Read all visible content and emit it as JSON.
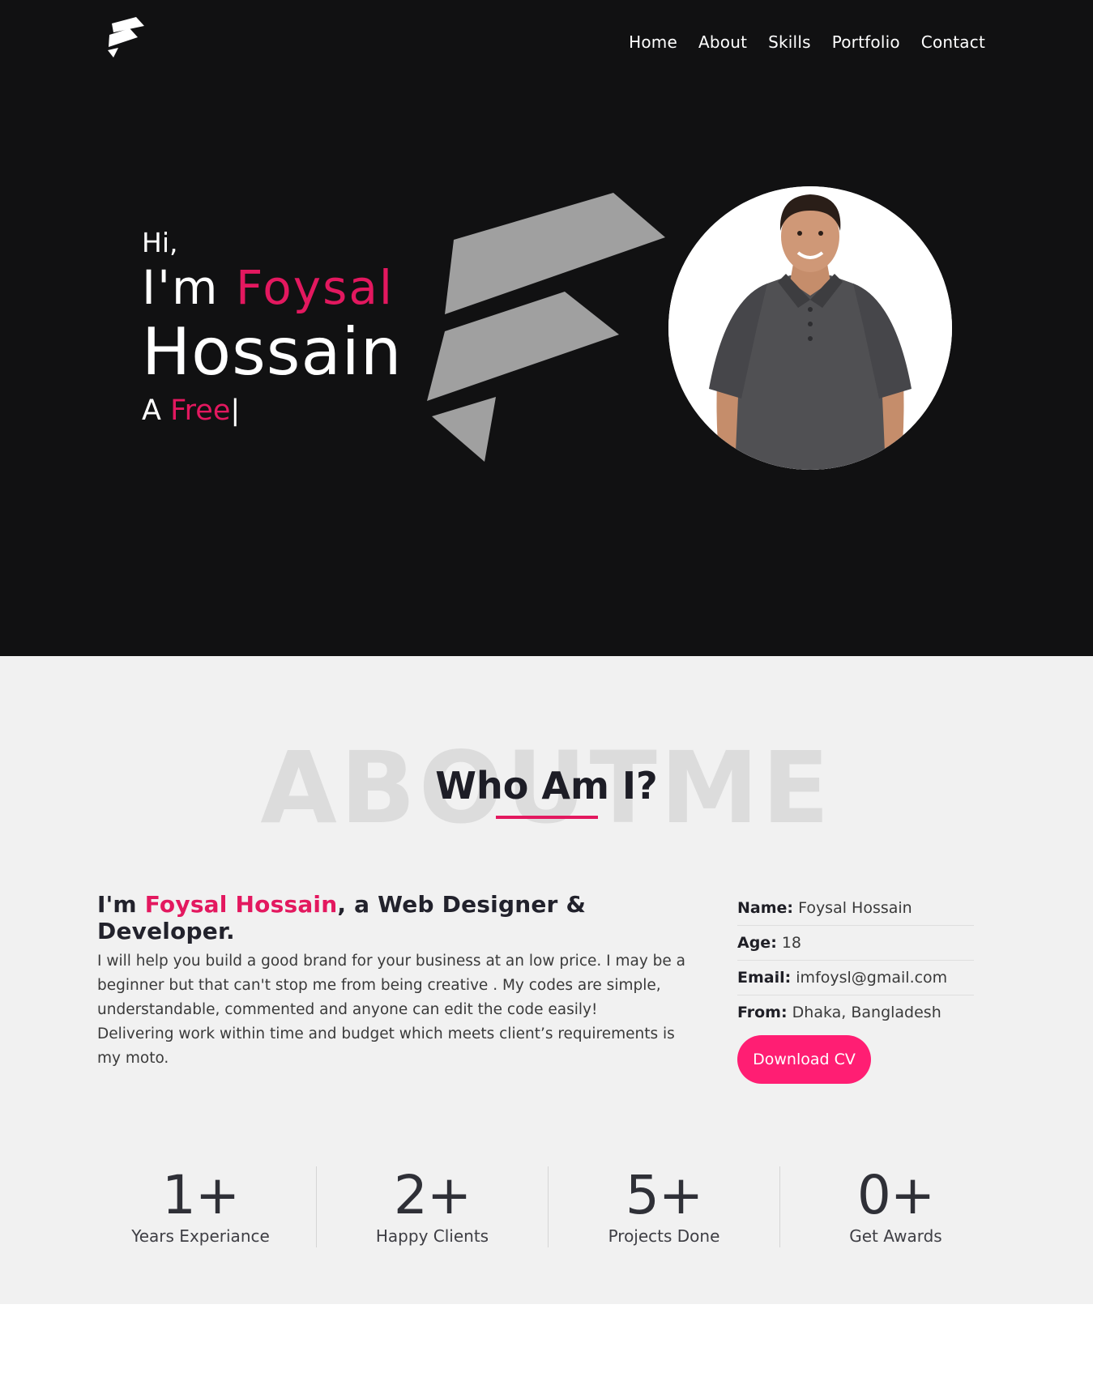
{
  "nav": {
    "logo_icon": "foysal-f-logo",
    "items": [
      {
        "label": "Home"
      },
      {
        "label": "About"
      },
      {
        "label": "Skills"
      },
      {
        "label": "Portfolio"
      },
      {
        "label": "Contact"
      }
    ]
  },
  "hero": {
    "greeting": "Hi,",
    "im": "I'm",
    "first_name": "Foysal",
    "last_name": "Hossain",
    "typed_prefix": "A",
    "typed_word": "Free",
    "cursor": "|",
    "accent_color": "#e3185f",
    "background": "#111112"
  },
  "about": {
    "watermark": "ABOUTME",
    "title": "Who Am I?",
    "intro_prefix": "I'm",
    "intro_name": "Foysal Hossain",
    "intro_suffix": ", a Web Designer & Developer.",
    "paragraph_1": "I will help you build a good brand for your business at an low price. I may be a beginner but that can't stop me from being creative . My codes are simple, understandable, commented and anyone can edit the code easily!",
    "paragraph_2": "Delivering work within time and budget which meets client’s requirements is my moto.",
    "info": [
      {
        "label": "Name:",
        "value": "Foysal Hossain"
      },
      {
        "label": "Age:",
        "value": "18"
      },
      {
        "label": "Email:",
        "value": "imfoysl@gmail.com"
      },
      {
        "label": "From:",
        "value": "Dhaka, Bangladesh"
      }
    ],
    "cv_button": "Download CV",
    "button_color": "#ff1e73"
  },
  "stats": [
    {
      "value": "1+",
      "label": "Years Experiance"
    },
    {
      "value": "2+",
      "label": "Happy Clients"
    },
    {
      "value": "5+",
      "label": "Projects Done"
    },
    {
      "value": "0+",
      "label": "Get Awards"
    }
  ]
}
